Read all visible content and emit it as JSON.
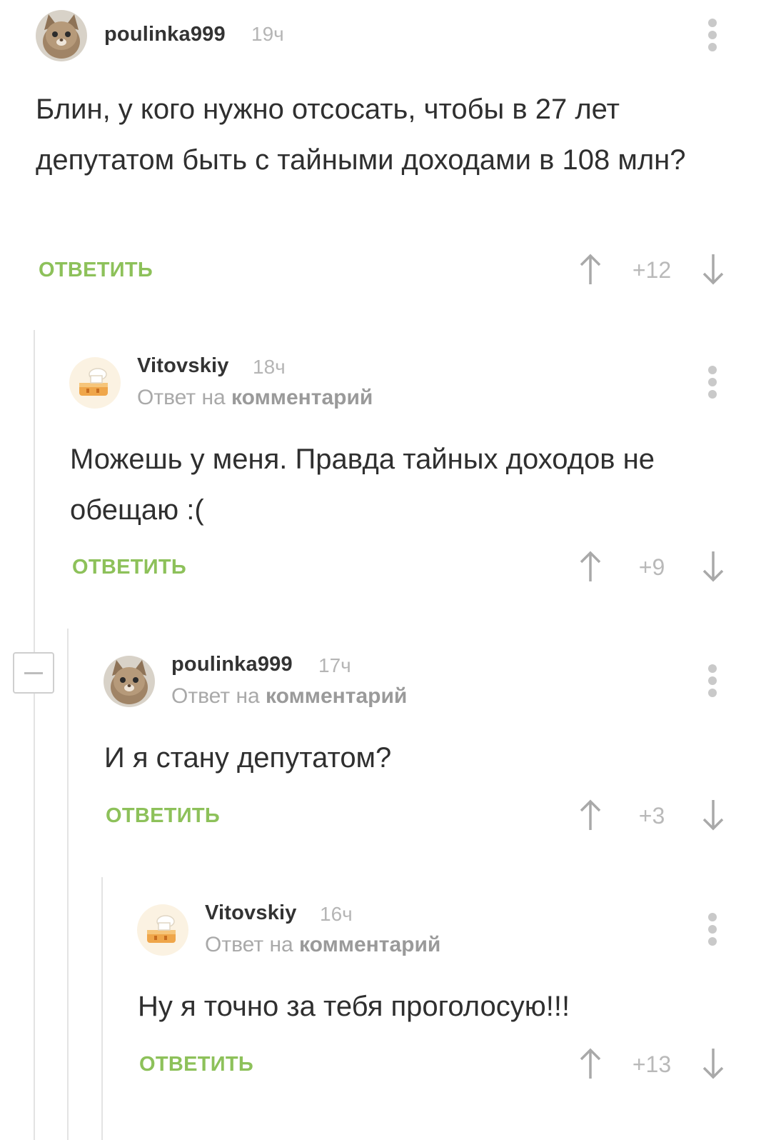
{
  "comments": [
    {
      "author": "poulinka999",
      "time": "19ч",
      "reply_label": "",
      "reply_link": "",
      "text": "Блин, у кого нужно отсосать, чтобы в 27 лет депутатом быть с тайными доходами в 108 млн?",
      "reply_button": "ОТВЕТИТЬ",
      "score": "+12"
    },
    {
      "author": "Vitovskiy",
      "time": "18ч",
      "reply_label": "Ответ на",
      "reply_link": "комментарий",
      "text": "Можешь у меня. Правда тайных доходов не обещаю :(",
      "reply_button": "ОТВЕТИТЬ",
      "score": "+9"
    },
    {
      "author": "poulinka999",
      "time": "17ч",
      "reply_label": "Ответ на",
      "reply_link": "комментарий",
      "text": "И я стану депутатом?",
      "reply_button": "ОТВЕТИТЬ",
      "score": "+3"
    },
    {
      "author": "Vitovskiy",
      "time": "16ч",
      "reply_label": "Ответ на",
      "reply_link": "комментарий",
      "text": "Ну я точно за тебя проголосую!!!",
      "reply_button": "ОТВЕТИТЬ",
      "score": "+13"
    }
  ],
  "colors": {
    "accent_green": "#8dc15a",
    "muted_gray": "#b5b5b5"
  },
  "icons": [
    "cat-avatar-icon",
    "cake-avatar-icon",
    "more-vertical-icon",
    "arrow-up-icon",
    "arrow-down-icon",
    "collapse-minus-icon"
  ]
}
